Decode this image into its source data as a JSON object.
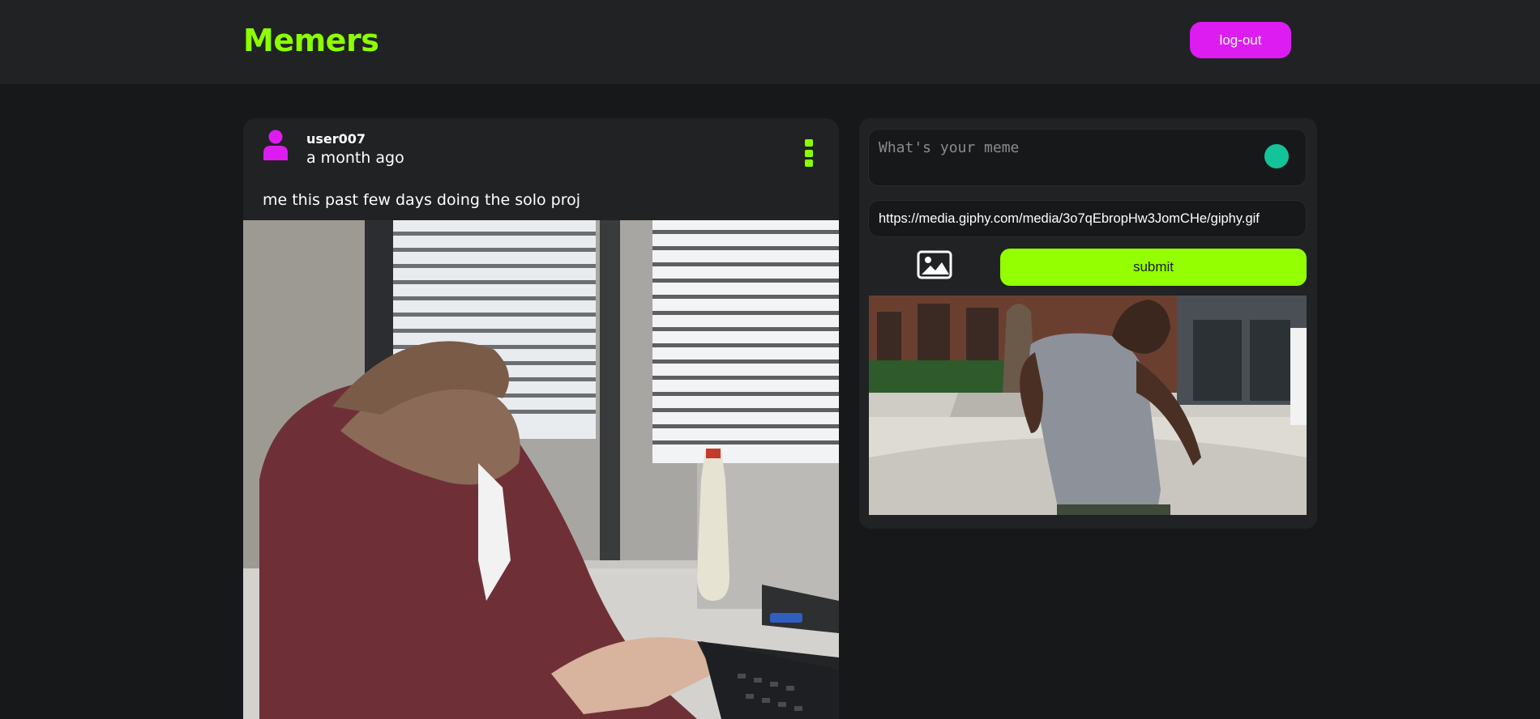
{
  "colors": {
    "brand": "#8cff00",
    "accent": "#dd1cf2",
    "submit": "#93ff00"
  },
  "header": {
    "logo": "Memers",
    "logout_label": "log-out"
  },
  "post": {
    "username": "user007",
    "time": "a month ago",
    "caption": "me this past few days doing the solo proj",
    "avatar_icon": "user-icon",
    "menu_icon": "vertical-dots-icon"
  },
  "composer": {
    "text_placeholder": "What's your meme",
    "url_value": "https://media.giphy.com/media/3o7qEbropHw3JomCHe/giphy.gif",
    "image_icon": "image-icon",
    "submit_label": "submit",
    "assistant_icon": "grammarly-icon"
  }
}
